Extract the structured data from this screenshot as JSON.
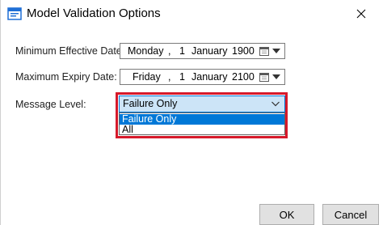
{
  "window": {
    "title": "Model Validation Options",
    "close_glyph": "✕"
  },
  "min_date": {
    "label": "Minimum Effective Date:",
    "weekday": "Monday",
    "separator": ",",
    "day": "1",
    "month": "January",
    "year": "1900",
    "calendar_icon": "calendar-icon"
  },
  "max_date": {
    "label": "Maximum Expiry Date:",
    "weekday": "Friday",
    "separator": ",",
    "day": "1",
    "month": "January",
    "year": "2100",
    "calendar_icon": "calendar-icon"
  },
  "message_level": {
    "label": "Message Level:",
    "selected": "Failure Only",
    "options": [
      "Failure Only",
      "All"
    ]
  },
  "buttons": {
    "ok": "OK",
    "cancel": "Cancel"
  },
  "colors": {
    "accent": "#0078d7",
    "combo_bg": "#cce4f7",
    "highlight": "#d6192a"
  }
}
